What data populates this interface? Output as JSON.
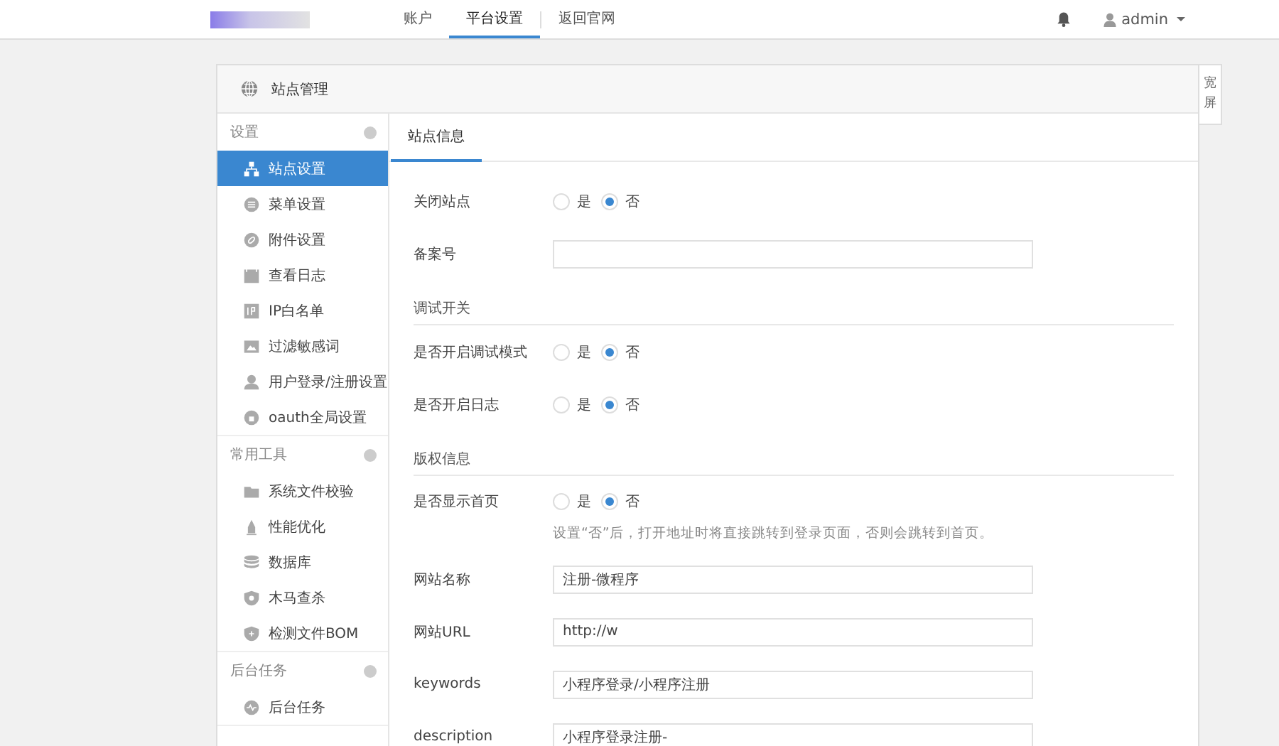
{
  "topbar": {
    "nav": [
      {
        "label": "账户",
        "selected": false
      },
      {
        "label": "平台设置",
        "selected": true
      },
      {
        "label": "返回官网",
        "selected": false
      }
    ],
    "user": "admin"
  },
  "widescreen_button": "宽屏",
  "panel": {
    "title": "站点管理"
  },
  "sidebar": {
    "groups": [
      {
        "title": "设置",
        "items": [
          {
            "label": "站点设置",
            "selected": true
          },
          {
            "label": "菜单设置",
            "selected": false
          },
          {
            "label": "附件设置",
            "selected": false
          },
          {
            "label": "查看日志",
            "selected": false
          },
          {
            "label": "IP白名单",
            "selected": false
          },
          {
            "label": "过滤敏感词",
            "selected": false
          },
          {
            "label": "用户登录/注册设置",
            "selected": false
          },
          {
            "label": "oauth全局设置",
            "selected": false
          }
        ]
      },
      {
        "title": "常用工具",
        "items": [
          {
            "label": "系统文件校验",
            "selected": false
          },
          {
            "label": "性能优化",
            "selected": false
          },
          {
            "label": "数据库",
            "selected": false
          },
          {
            "label": "木马查杀",
            "selected": false
          },
          {
            "label": "检测文件BOM",
            "selected": false
          }
        ]
      },
      {
        "title": "后台任务",
        "items": [
          {
            "label": "后台任务",
            "selected": false
          }
        ]
      }
    ]
  },
  "tabs": [
    {
      "label": "站点信息",
      "selected": true
    }
  ],
  "form": [
    {
      "kind": "radio",
      "label": "关闭站点",
      "options": [
        {
          "label": "是",
          "selected": false
        },
        {
          "label": "否",
          "selected": true
        }
      ]
    },
    {
      "kind": "text",
      "label": "备案号"
    },
    {
      "kind": "section",
      "label": "调试开关"
    },
    {
      "kind": "radio",
      "label": "是否开启调试模式",
      "options": [
        {
          "label": "是",
          "selected": false
        },
        {
          "label": "否",
          "selected": true
        }
      ]
    },
    {
      "kind": "radio",
      "label": "是否开启日志",
      "options": [
        {
          "label": "是",
          "selected": false
        },
        {
          "label": "否",
          "selected": true
        }
      ]
    },
    {
      "kind": "section",
      "label": "版权信息"
    },
    {
      "kind": "radio",
      "label": "是否显示首页",
      "options": [
        {
          "label": "是",
          "selected": false
        },
        {
          "label": "否",
          "selected": true
        }
      ],
      "hint": "设置“否”后，打开地址时将直接跳转到登录页面，否则会跳转到首页。"
    },
    {
      "kind": "text",
      "label": "网站名称",
      "value": "注册-微程序"
    },
    {
      "kind": "text",
      "label": "网站URL",
      "value": "http://w"
    },
    {
      "kind": "text",
      "label": "keywords",
      "value": "小程序登录/小程序注册"
    },
    {
      "kind": "text",
      "label": "description",
      "value": "小程序登录注册-"
    }
  ]
}
